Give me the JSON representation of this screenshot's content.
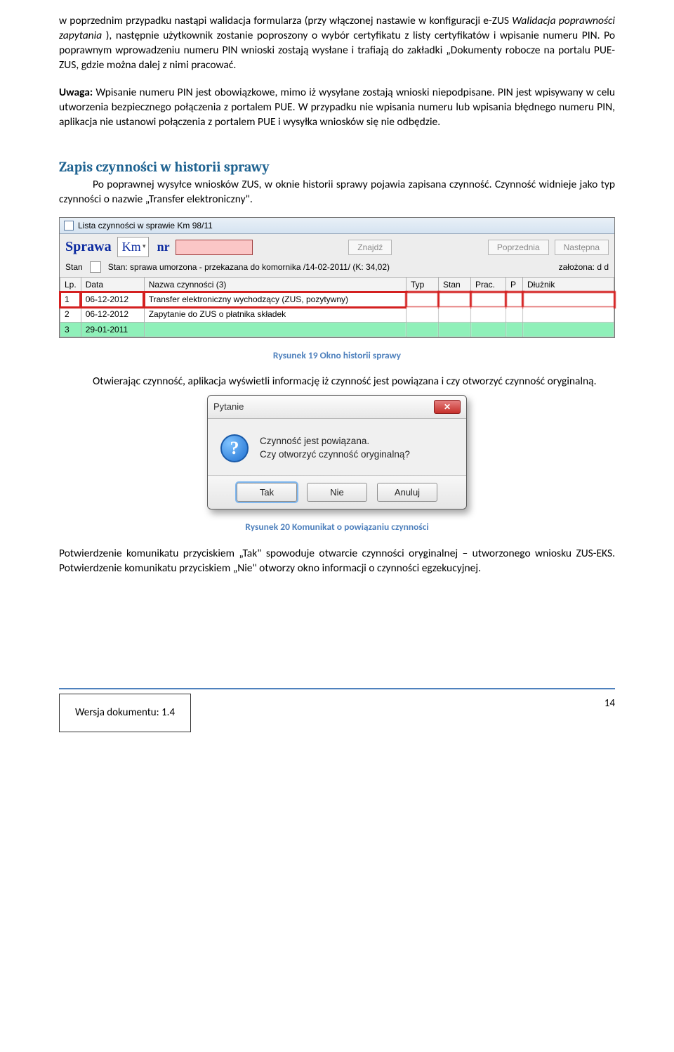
{
  "para1_a": "w poprzednim przypadku nastąpi walidacja formularza (przy włączonej nastawie w konfiguracji e-ZUS ",
  "para1_b": "Walidacja poprawności zapytania ",
  "para1_c": "), następnie użytkownik zostanie poproszony o wybór certyfikatu z listy certyfikatów i wpisanie numeru PIN. Po poprawnym wprowadzeniu numeru PIN wnioski zostają wysłane i trafiają do zakładki „Dokumenty robocze na portalu PUE-ZUS, gdzie można dalej z nimi pracować.",
  "para2_a": "Uwaga:",
  "para2_b": " Wpisanie numeru PIN jest obowiązkowe, mimo iż wysyłane zostają wnioski niepodpisane. PIN jest wpisywany w celu utworzenia bezpiecznego połączenia z portalem PUE. W przypadku nie wpisania numeru lub wpisania błędnego numeru PIN, aplikacja nie ustanowi połączenia z portalem PUE i wysyłka wniosków się nie odbędzie.",
  "heading": "Zapis czynności w historii sprawy",
  "para3": "Po poprawnej  wysyłce wniosków ZUS, w oknie historii sprawy pojawia zapisana czynność. Czynność widnieje jako typ czynności o nazwie „Transfer elektroniczny\".",
  "win": {
    "title": "Lista czynności w sprawie Km 98/11",
    "sprawa": "Sprawa",
    "km": "Km",
    "nr": "nr",
    "znajdz": "Znajdź",
    "poprzednia": "Poprzednia",
    "nastepna": "Następna",
    "stan_label": "Stan",
    "stan_text": "Stan:      sprawa umorzona - przekazana do komornika  /14-02-2011/ (K: 34,02)",
    "zalozona": "założona:   d d",
    "cols": {
      "lp": "Lp.",
      "data": "Data",
      "nazwa": "Nazwa czynności  (3)",
      "typ": "Typ",
      "stan": "Stan",
      "prac": "Prac.",
      "p": "P",
      "dluznik": "Dłużnik"
    },
    "rows": [
      {
        "lp": "1",
        "data": "06-12-2012",
        "nazwa": "Transfer elektroniczny wychodzący (ZUS, pozytywny)"
      },
      {
        "lp": "2",
        "data": "06-12-2012",
        "nazwa": "Zapytanie do ZUS o płatnika składek"
      },
      {
        "lp": "3",
        "data": "29-01-2011",
        "nazwa": ""
      }
    ]
  },
  "caption1": "Rysunek 19 Okno historii sprawy",
  "para4": "Otwierając czynność, aplikacja wyświetli informację iż czynność jest powiązana i czy otworzyć czynność oryginalną.",
  "dlg": {
    "title": "Pytanie",
    "line1": "Czynność jest powiązana.",
    "line2": "Czy otworzyć czynność oryginalną?",
    "tak": "Tak",
    "nie": "Nie",
    "anuluj": "Anuluj"
  },
  "caption2": "Rysunek 20 Komunikat o powiązaniu czynności",
  "para5": "Potwierdzenie komunikatu przyciskiem „Tak\" spowoduje otwarcie czynności oryginalnej – utworzonego wniosku ZUS-EKS. Potwierdzenie komunikatu przyciskiem „Nie\" otworzy okno informacji o czynności egzekucyjnej.",
  "footer_version": "Wersja dokumentu: 1.4",
  "page_no": "14"
}
